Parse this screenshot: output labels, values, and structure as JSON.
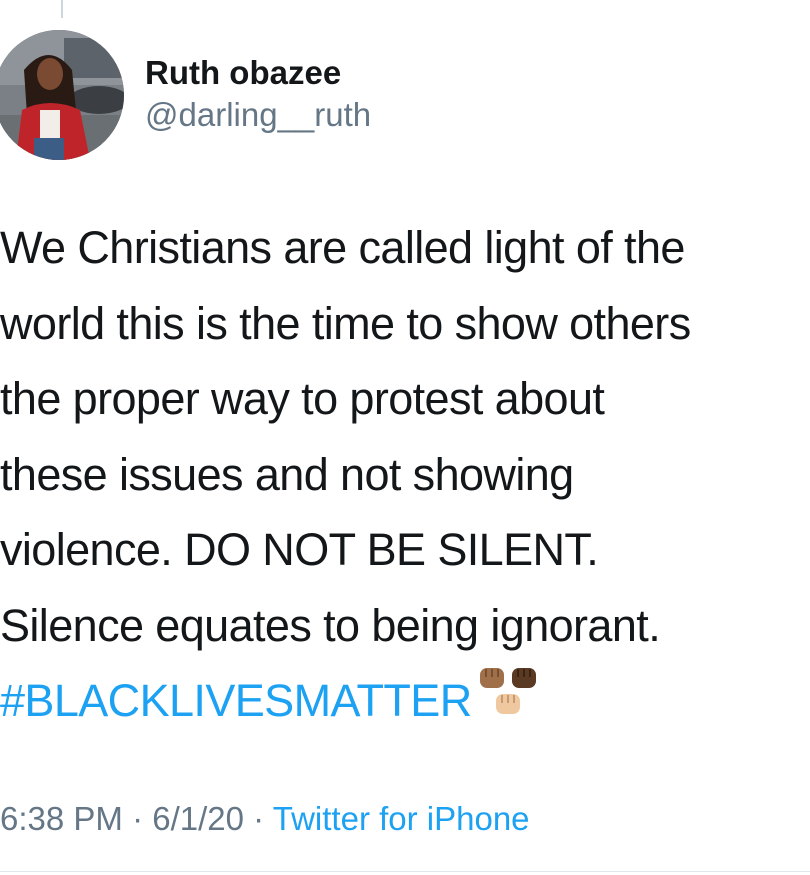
{
  "tweet": {
    "author": {
      "display_name": "Ruth obazee",
      "handle": "@darling__ruth",
      "avatar_icon": "profile-photo"
    },
    "text_lines": [
      "We Christians are called light of the",
      "world this is the time to show others",
      "the proper way to protest about",
      "these issues and not showing",
      "violence. DO NOT BE SILENT.",
      "Silence equates to being ignorant."
    ],
    "hashtag": "#BLACKLIVESMATTER",
    "emoji_icon": "raised-fists-emoji",
    "meta": {
      "time": "6:38 PM",
      "separator": "·",
      "date": "6/1/20",
      "source": "Twitter for iPhone"
    }
  },
  "colors": {
    "text": "#14171a",
    "secondary": "#657786",
    "link": "#1da1f2"
  }
}
